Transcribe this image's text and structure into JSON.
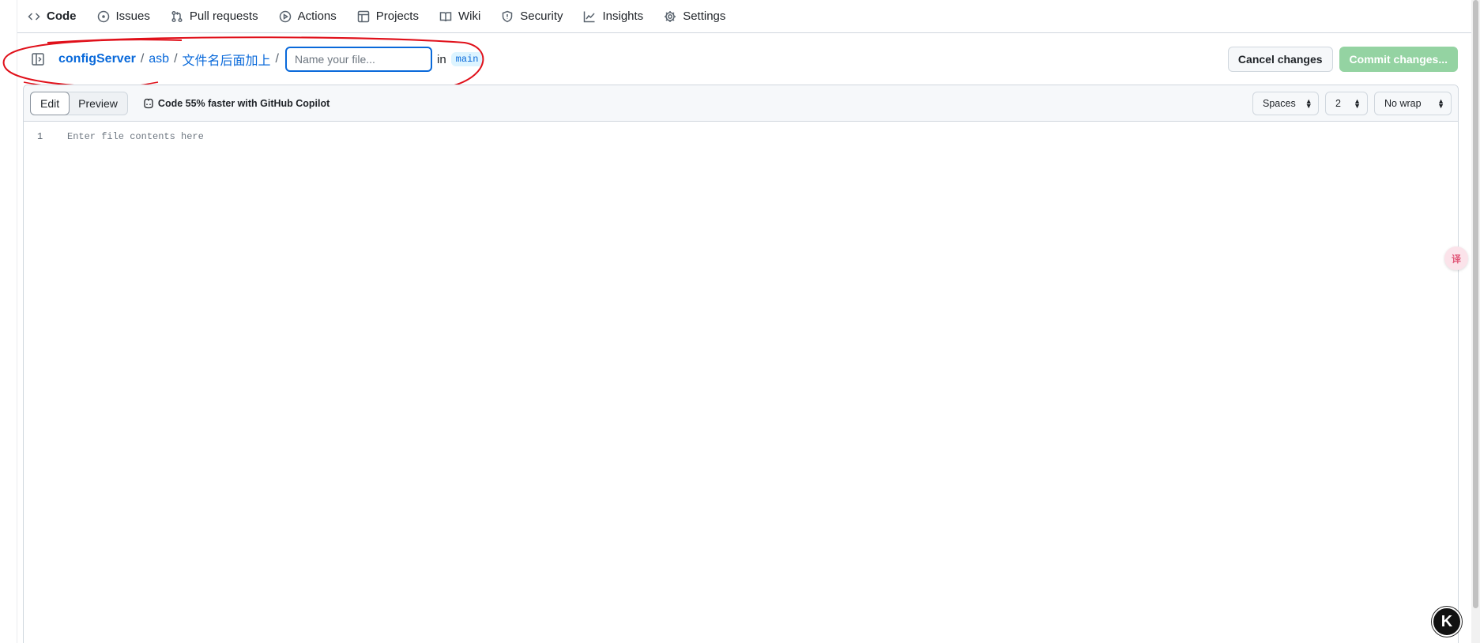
{
  "nav": {
    "items": [
      {
        "label": "Code",
        "icon": "code-icon",
        "active": true
      },
      {
        "label": "Issues",
        "icon": "issue-opened-icon"
      },
      {
        "label": "Pull requests",
        "icon": "git-pull-request-icon"
      },
      {
        "label": "Actions",
        "icon": "play-icon"
      },
      {
        "label": "Projects",
        "icon": "table-icon"
      },
      {
        "label": "Wiki",
        "icon": "book-icon"
      },
      {
        "label": "Security",
        "icon": "shield-icon"
      },
      {
        "label": "Insights",
        "icon": "graph-icon"
      },
      {
        "label": "Settings",
        "icon": "gear-icon"
      }
    ]
  },
  "breadcrumb": {
    "repo": "configServer",
    "sep": "/",
    "folder1": "asb",
    "folder2": "文件名后面加上",
    "filename_placeholder": "Name your file...",
    "filename_value": "",
    "in_text": "in",
    "branch": "main"
  },
  "actions": {
    "cancel_label": "Cancel changes",
    "commit_label": "Commit changes..."
  },
  "editor": {
    "tabs": [
      {
        "label": "Edit",
        "active": true
      },
      {
        "label": "Preview",
        "active": false
      }
    ],
    "copilot_text": "Code 55% faster with GitHub Copilot",
    "indent_mode": "Spaces",
    "indent_size": "2",
    "wrap_mode": "No wrap",
    "line_number": "1",
    "placeholder": "Enter file contents here"
  },
  "widgets": {
    "k_label": "K"
  },
  "colors": {
    "accent": "#0969da",
    "annotation": "#e0101a",
    "commit_disabled": "#94d3a2"
  }
}
